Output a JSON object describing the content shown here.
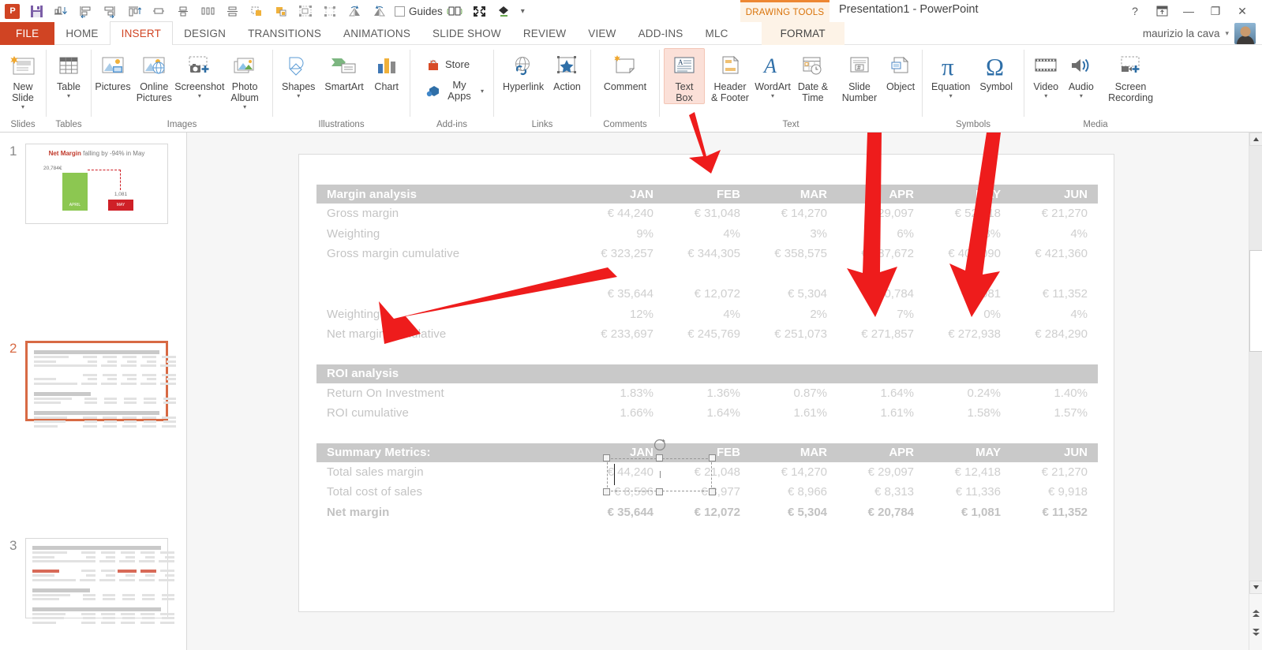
{
  "titlebar": {
    "doc_title": "Presentation1 - PowerPoint",
    "contextual_tab_label": "DRAWING TOOLS",
    "guides_label": "Guides",
    "qat_items": [
      {
        "name": "powerpoint-logo",
        "label": "P"
      },
      {
        "name": "save-icon",
        "label": "Save"
      },
      {
        "name": "align-distribute-icon",
        "label": "Align"
      },
      {
        "name": "align-left-icon",
        "label": "Align Left"
      },
      {
        "name": "align-right-icon",
        "label": "Align Right"
      },
      {
        "name": "align-top-icon",
        "label": "Align Top"
      },
      {
        "name": "align-middle-icon",
        "label": "Align Middle"
      },
      {
        "name": "align-center-icon",
        "label": "Align Center"
      },
      {
        "name": "distribute-horizontal-icon",
        "label": "Distribute Horizontally"
      },
      {
        "name": "distribute-vertical-icon",
        "label": "Distribute Vertically"
      },
      {
        "name": "bring-forward-icon",
        "label": "Bring Forward"
      },
      {
        "name": "send-backward-icon",
        "label": "Send Backward"
      },
      {
        "name": "group-icon",
        "label": "Group"
      },
      {
        "name": "ungroup-icon",
        "label": "Ungroup"
      },
      {
        "name": "flip-horizontal-icon",
        "label": "Flip Horizontal"
      },
      {
        "name": "flip-vertical-icon",
        "label": "Flip Vertical"
      }
    ],
    "customize_caret": "▾",
    "help_glyph": "?",
    "ribbon_display_glyph": "⬓",
    "minimize_glyph": "—",
    "restore_glyph": "❐",
    "close_glyph": "✕"
  },
  "tabs": [
    {
      "label": "FILE",
      "state": "file"
    },
    {
      "label": "HOME",
      "state": "normal"
    },
    {
      "label": "INSERT",
      "state": "active"
    },
    {
      "label": "DESIGN",
      "state": "normal"
    },
    {
      "label": "TRANSITIONS",
      "state": "normal"
    },
    {
      "label": "ANIMATIONS",
      "state": "normal"
    },
    {
      "label": "SLIDE SHOW",
      "state": "normal"
    },
    {
      "label": "REVIEW",
      "state": "normal"
    },
    {
      "label": "VIEW",
      "state": "normal"
    },
    {
      "label": "ADD-INS",
      "state": "normal"
    },
    {
      "label": "MLC",
      "state": "normal"
    },
    {
      "label": "FORMAT",
      "state": "contextual"
    }
  ],
  "account": {
    "user_name": "maurizio la cava",
    "caret": "▾"
  },
  "ribbon": {
    "groups": [
      {
        "name": "slides",
        "label": "Slides",
        "buttons": [
          {
            "name": "new-slide-button",
            "label": "New Slide",
            "caret": "▾",
            "icon": "new-slide-icon"
          }
        ]
      },
      {
        "name": "tables",
        "label": "Tables",
        "buttons": [
          {
            "name": "table-button",
            "label": "Table",
            "caret": "▾",
            "icon": "table-icon"
          }
        ]
      },
      {
        "name": "images",
        "label": "Images",
        "buttons": [
          {
            "name": "pictures-button",
            "label": "Pictures",
            "caret": "",
            "icon": "pictures-icon"
          },
          {
            "name": "online-pictures-button",
            "label": "Online Pictures",
            "caret": "",
            "icon": "online-pictures-icon"
          },
          {
            "name": "screenshot-button",
            "label": "Screenshot",
            "caret": "▾",
            "icon": "screenshot-icon"
          },
          {
            "name": "photo-album-button",
            "label": "Photo Album",
            "caret": "▾",
            "icon": "photo-album-icon"
          }
        ]
      },
      {
        "name": "illustrations",
        "label": "Illustrations",
        "buttons": [
          {
            "name": "shapes-button",
            "label": "Shapes",
            "caret": "▾",
            "icon": "shapes-icon"
          },
          {
            "name": "smartart-button",
            "label": "SmartArt",
            "caret": "",
            "icon": "smartart-icon"
          },
          {
            "name": "chart-button",
            "label": "Chart",
            "caret": "",
            "icon": "chart-icon"
          }
        ]
      },
      {
        "name": "add-ins",
        "label": "Add-ins",
        "buttons": [
          {
            "name": "store-button",
            "label": "Store",
            "caret": "",
            "icon": "store-icon"
          },
          {
            "name": "my-apps-button",
            "label": "My Apps",
            "caret": "▾",
            "icon": "my-apps-icon"
          }
        ]
      },
      {
        "name": "links",
        "label": "Links",
        "buttons": [
          {
            "name": "hyperlink-button",
            "label": "Hyperlink",
            "caret": "",
            "icon": "hyperlink-icon"
          },
          {
            "name": "action-button",
            "label": "Action",
            "caret": "",
            "icon": "action-icon"
          }
        ]
      },
      {
        "name": "comments",
        "label": "Comments",
        "buttons": [
          {
            "name": "comment-button",
            "label": "Comment",
            "caret": "",
            "icon": "comment-icon"
          }
        ]
      },
      {
        "name": "text",
        "label": "Text",
        "buttons": [
          {
            "name": "text-box-button",
            "label": "Text Box",
            "caret": "",
            "icon": "text-box-icon",
            "selected": true
          },
          {
            "name": "header-footer-button",
            "label": "Header & Footer",
            "caret": "",
            "icon": "header-footer-icon"
          },
          {
            "name": "wordart-button",
            "label": "WordArt",
            "caret": "▾",
            "icon": "wordart-icon"
          },
          {
            "name": "date-time-button",
            "label": "Date & Time",
            "caret": "",
            "icon": "date-time-icon"
          },
          {
            "name": "slide-number-button",
            "label": "Slide Number",
            "caret": "",
            "icon": "slide-number-icon"
          },
          {
            "name": "object-button",
            "label": "Object",
            "caret": "",
            "icon": "object-icon"
          }
        ]
      },
      {
        "name": "symbols",
        "label": "Symbols",
        "buttons": [
          {
            "name": "equation-button",
            "label": "Equation",
            "caret": "▾",
            "icon": "equation-icon"
          },
          {
            "name": "symbol-button",
            "label": "Symbol",
            "caret": "",
            "icon": "symbol-icon"
          }
        ]
      },
      {
        "name": "media",
        "label": "Media",
        "buttons": [
          {
            "name": "video-button",
            "label": "Video",
            "caret": "▾",
            "icon": "video-icon"
          },
          {
            "name": "audio-button",
            "label": "Audio",
            "caret": "▾",
            "icon": "audio-icon"
          },
          {
            "name": "screen-recording-button",
            "label": "Screen Recording",
            "caret": "",
            "icon": "screen-recording-icon"
          }
        ]
      }
    ],
    "collapse_glyph": "⌃"
  },
  "thumbnails": [
    {
      "number": "1",
      "selected": false,
      "kind": "chart"
    },
    {
      "number": "2",
      "selected": true,
      "kind": "table"
    },
    {
      "number": "3",
      "selected": false,
      "kind": "table-highlight"
    }
  ],
  "thumb_slide1": {
    "title_bold": "Net Margin",
    "title_rest": " falling by -94% in May",
    "value_april": "20,784€",
    "value_may": "1,081",
    "label_april": "APRIL",
    "label_may": "MAY"
  },
  "thumb_slide3": {
    "highlight_label": "Net Margin",
    "highlight_apr": "€ 20,784",
    "highlight_may": "€ 1,081"
  },
  "slide": {
    "months": [
      "JAN",
      "FEB",
      "MAR",
      "APR",
      "MAY",
      "JUN"
    ],
    "sections": [
      {
        "name": "margin-analysis",
        "header": "Margin analysis",
        "rows": [
          {
            "label": "Gross margin",
            "values": [
              "€ 44,240",
              "€ 31,048",
              "€ 14,270",
              "€ 29,097",
              "€ 52,418",
              "€ 21,270"
            ],
            "bold": false
          },
          {
            "label": "Weighting",
            "values": [
              "9%",
              "4%",
              "3%",
              "6%",
              "8%",
              "4%"
            ],
            "bold": false
          },
          {
            "label": "Gross margin cumulative",
            "values": [
              "€ 323,257",
              "€ 344,305",
              "€ 358,575",
              "€ 387,672",
              "€ 400,090",
              "€ 421,360"
            ],
            "bold": false
          },
          {
            "label": "",
            "values": [
              "",
              "",
              "",
              "",
              "",
              ""
            ],
            "bold": false
          },
          {
            "label": "",
            "values": [
              "€ 35,644",
              "€ 12,072",
              "€ 5,304",
              "€ 20,784",
              "€ 1,081",
              "€ 11,352"
            ],
            "bold": false
          },
          {
            "label": "Weighting",
            "values": [
              "12%",
              "4%",
              "2%",
              "7%",
              "0%",
              "4%"
            ],
            "bold": false
          },
          {
            "label": "Net margin cumulative",
            "values": [
              "€ 233,697",
              "€ 245,769",
              "€ 251,073",
              "€ 271,857",
              "€ 272,938",
              "€ 284,290"
            ],
            "bold": false
          }
        ]
      },
      {
        "name": "roi-analysis",
        "header": "ROI analysis",
        "rows": [
          {
            "label": "Return On Investment",
            "values": [
              "1.83%",
              "1.36%",
              "0.87%",
              "1.64%",
              "0.24%",
              "1.40%"
            ],
            "bold": false
          },
          {
            "label": "ROI cumulative",
            "values": [
              "1.66%",
              "1.64%",
              "1.61%",
              "1.61%",
              "1.58%",
              "1.57%"
            ],
            "bold": false
          }
        ]
      },
      {
        "name": "summary-metrics",
        "header": "Summary Metrics:",
        "show_months": true,
        "rows": [
          {
            "label": "Total sales margin",
            "values": [
              "€ 44,240",
              "€ 21,048",
              "€ 14,270",
              "€ 29,097",
              "€ 12,418",
              "€ 21,270"
            ],
            "bold": false
          },
          {
            "label": "Total cost of sales",
            "values": [
              "€ 8,596",
              "€ 8,977",
              "€ 8,966",
              "€ 8,313",
              "€ 11,336",
              "€ 9,918"
            ],
            "bold": false
          },
          {
            "label": "Net margin",
            "values": [
              "€ 35,644",
              "€ 12,072",
              "€ 5,304",
              "€ 20,784",
              "€ 1,081",
              "€ 11,352"
            ],
            "bold": true
          }
        ]
      }
    ]
  },
  "textbox": {
    "name": "inserted-text-box",
    "content": "",
    "state": "selected-editing"
  },
  "annotations": {
    "arrow_color": "#ee1c1c",
    "arrows": [
      {
        "name": "arrow-to-text-box-button",
        "target": "Text Box ribbon button"
      },
      {
        "name": "arrow-to-new-text-box",
        "target": "new text box on slide"
      },
      {
        "name": "arrow-to-april-net-margin",
        "target": "€ 20,784"
      },
      {
        "name": "arrow-to-may-net-margin",
        "target": "€ 1,081"
      }
    ]
  },
  "scrollbar": {
    "up_glyph": "▲",
    "down_glyph": "▼",
    "prev_slide_glyph": "⏶",
    "next_slide_glyph": "⏷"
  },
  "colors": {
    "accent_red": "#d04423",
    "arrow_red": "#ee1c1c",
    "table_header_gray": "#c9c9c9",
    "table_text_gray": "#cfcfcf",
    "contextual_orange": "#ed8733",
    "thumb_selected_border": "#d86a44"
  }
}
